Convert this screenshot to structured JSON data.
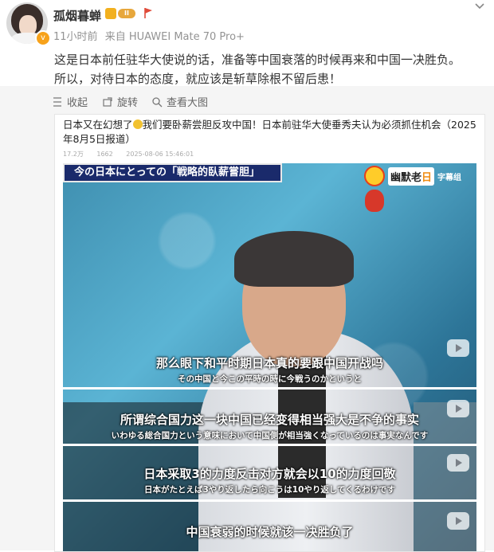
{
  "post": {
    "username": "孤烟暮蝉",
    "level_badge": "II",
    "time": "11小时前",
    "source": "来自 HUAWEI Mate 70 Pro+",
    "text_lines": [
      "这是日本前任驻华大使说的话，准备等中国衰落的时候再来和中国一决胜负。",
      "所以，对待日本的态度，就应该是斩草除根不留后患！"
    ]
  },
  "toolbar": {
    "collapse": "收起",
    "rotate": "旋转",
    "view_large": "查看大图"
  },
  "article": {
    "headline_part1": "日本又在幻想了",
    "headline_part2": "我们要卧薪尝胆反攻中国！日本前驻华大使垂秀夫认为必须抓住机会（2025年8月5日报道）",
    "views": "17.2万",
    "comments": "1662",
    "date": "2025-08-06 15:46:01"
  },
  "video": {
    "banner": "今の日本にとっての「戦略的臥薪嘗胆」",
    "logo_text": "幽默老日",
    "logo_highlight": "日",
    "logo_prefix": "幽默老",
    "logo_sub": "字幕组",
    "subtitles": [
      {
        "cn": "那么眼下和平时期日本真的要跟中国开战吗",
        "jp": "その中国と今この平時の時に今戦うのかというと"
      },
      {
        "cn": "所谓综合国力这一块中国已经变得相当强大是不争的事实",
        "jp": "いわゆる総合国力という意味において中国側が相当強くなっているのは事実なんです"
      },
      {
        "cn": "日本采取3的力度反击对方就会以10的力度回敬",
        "jp": "日本がたとえば3やり返したら向こうは10やり返してくるわけです"
      },
      {
        "cn": "中国衰弱的时候就该一决胜负了",
        "jp": ""
      }
    ]
  },
  "colors": {
    "banner_bg": "#1a2a6b",
    "meta_gray": "#939393",
    "crown_gold": "#f2b01e"
  }
}
